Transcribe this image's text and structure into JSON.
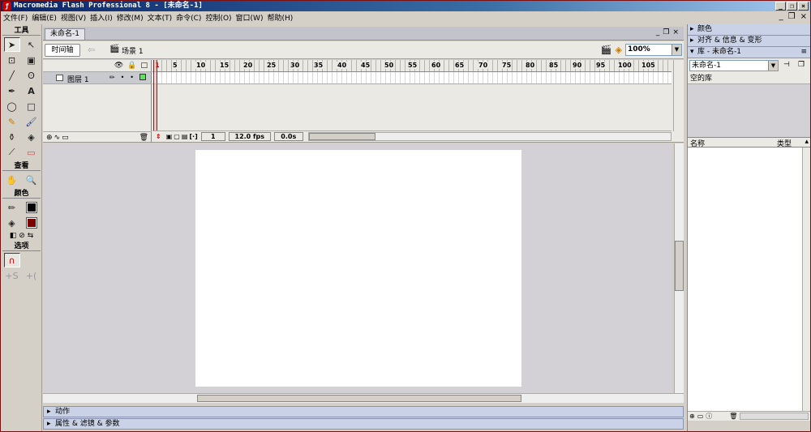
{
  "app": {
    "title": "Macromedia Flash Professional 8 - [未命名-1]",
    "logo_glyph": "ƒ",
    "window_controls": [
      "_",
      "❐",
      "×"
    ]
  },
  "menubar": {
    "items": [
      "文件(F)",
      "编辑(E)",
      "视图(V)",
      "插入(I)",
      "修改(M)",
      "文本(T)",
      "命令(C)",
      "控制(O)",
      "窗口(W)",
      "帮助(H)"
    ],
    "doc_controls": [
      "_",
      "❐",
      "×"
    ]
  },
  "toolbox": {
    "tools_label": "工具",
    "view_label": "查看",
    "colors_label": "颜色",
    "options_label": "选项"
  },
  "document": {
    "tab_label": "未命名-1",
    "timeline_toggle": "时间轴",
    "scene_label": "场景 1",
    "zoom": "100%"
  },
  "timeline": {
    "layer_name": "图层 1",
    "ruler_numbers": [
      "1",
      "5",
      "10",
      "15",
      "20",
      "25",
      "30",
      "35",
      "40",
      "45",
      "50",
      "55",
      "60",
      "65",
      "70",
      "75",
      "80",
      "85",
      "90",
      "95",
      "100",
      "105"
    ],
    "current_frame": "1",
    "fps": "12.0 fps",
    "elapsed": "0.0s"
  },
  "panels": {
    "actions": "动作",
    "properties": "属性 & 滤镜 & 参数",
    "color": "颜色",
    "align": "对齐 & 信息 & 变形",
    "library_title": "库 - 未命名-1",
    "library_select": "未命名-1",
    "library_empty": "空的库",
    "col_name": "名称",
    "col_type": "类型"
  },
  "colors": {
    "stroke": "#000000",
    "fill": "#7a0000",
    "accent": "#c00000"
  }
}
